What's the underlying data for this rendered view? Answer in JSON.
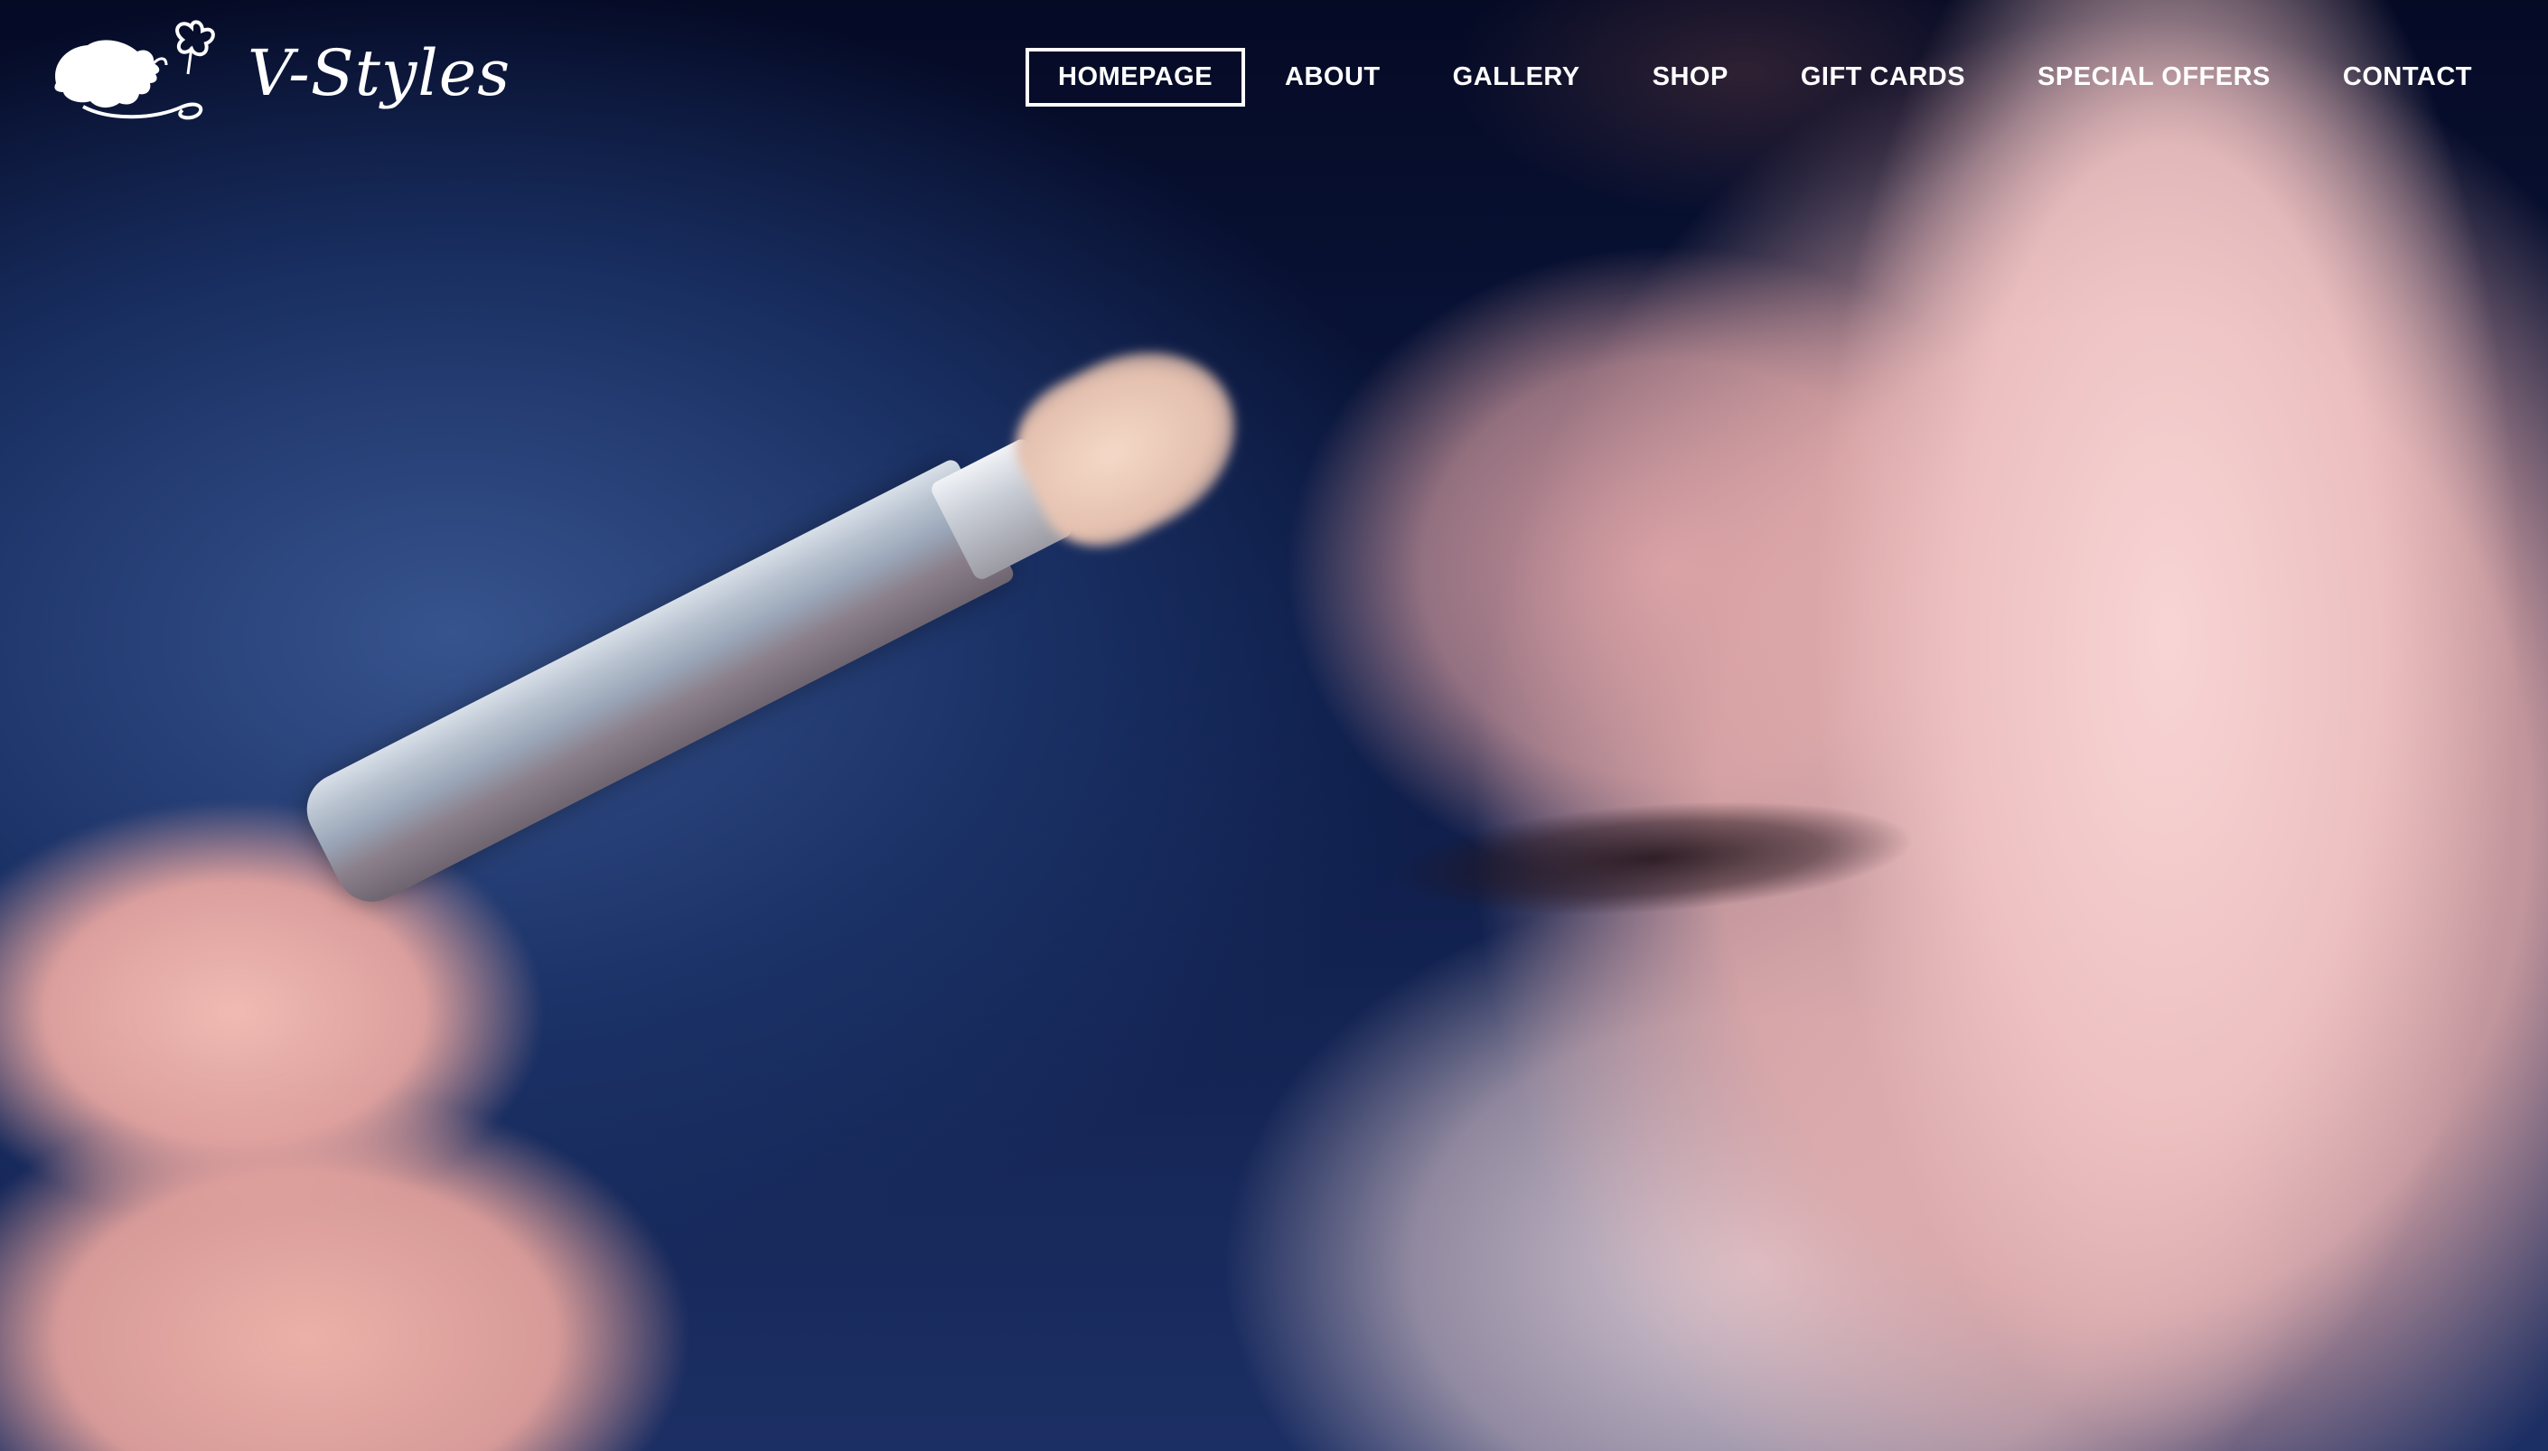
{
  "site": {
    "logo_text": "V-Styles",
    "logo_icon": "woman-profile-butterfly-logo-icon"
  },
  "nav": {
    "active": "HOMEPAGE",
    "items": [
      {
        "label": "HOMEPAGE"
      },
      {
        "label": "ABOUT"
      },
      {
        "label": "GALLERY"
      },
      {
        "label": "SHOP"
      },
      {
        "label": "GIFT CARDS"
      },
      {
        "label": "SPECIAL OFFERS"
      },
      {
        "label": "CONTACT"
      }
    ]
  },
  "colors": {
    "nav_text": "#ffffff",
    "active_border": "#ffffff",
    "background": "#0b1430"
  }
}
